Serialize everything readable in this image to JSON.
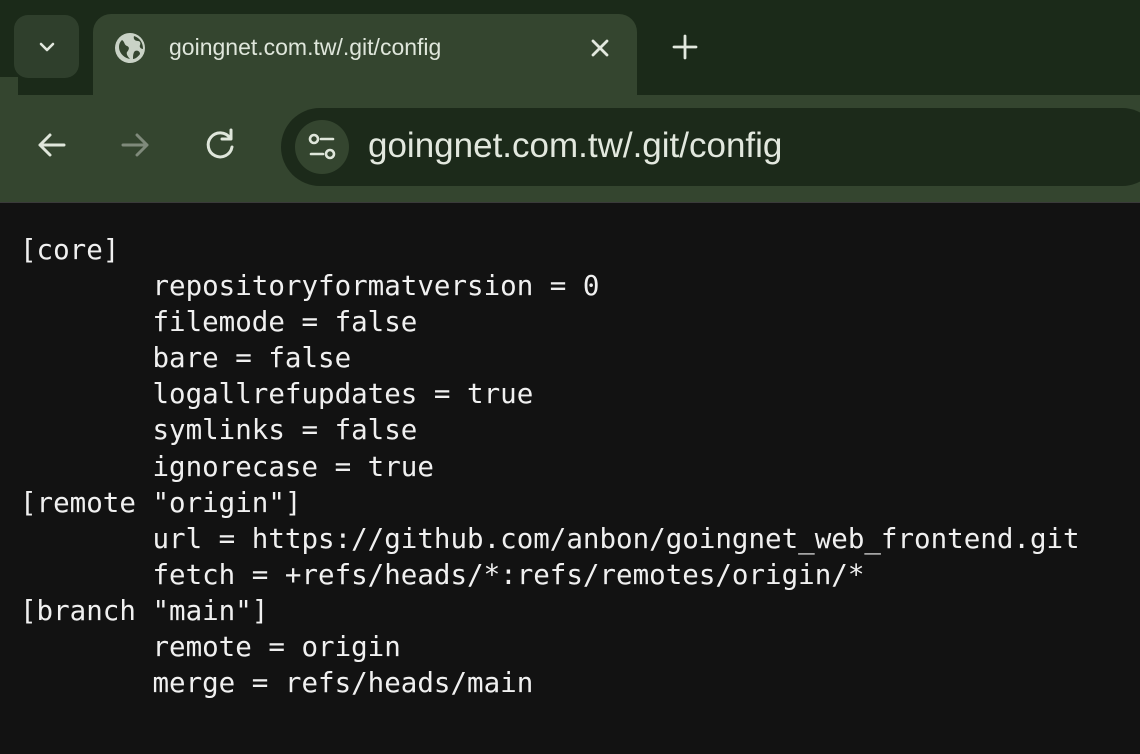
{
  "browser": {
    "tab": {
      "title": "goingnet.com.tw/.git/config"
    },
    "omnibox": {
      "url": "goingnet.com.tw/.git/config"
    }
  },
  "icons": {
    "tab_search": "chevron-down-icon",
    "favicon": "globe-icon",
    "close_tab": "close-icon",
    "new_tab": "plus-icon",
    "back": "arrow-left-icon",
    "forward": "arrow-right-icon",
    "reload": "reload-icon",
    "site_info": "tune-icon"
  },
  "colors": {
    "tabstrip_bg": "#1b2a19",
    "toolbar_bg": "#34452f",
    "page_bg": "#121212",
    "text": "#f0f0f0"
  },
  "content": {
    "lines": [
      "[core]",
      "\trepositoryformatversion = 0",
      "\tfilemode = false",
      "\tbare = false",
      "\tlogallrefupdates = true",
      "\tsymlinks = false",
      "\tignorecase = true",
      "[remote \"origin\"]",
      "\turl = https://github.com/anbon/goingnet_web_frontend.git",
      "\tfetch = +refs/heads/*:refs/remotes/origin/*",
      "[branch \"main\"]",
      "\tremote = origin",
      "\tmerge = refs/heads/main"
    ]
  }
}
